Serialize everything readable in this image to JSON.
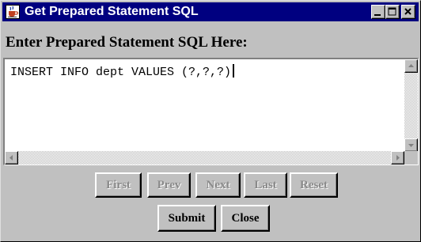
{
  "window": {
    "title": "Get Prepared Statement SQL",
    "controls": {
      "minimize": "minimize-icon",
      "maximize": "maximize-icon",
      "close": "close-icon"
    }
  },
  "prompt": "Enter Prepared Statement SQL Here:",
  "editor": {
    "value": "INSERT INFO dept VALUES (?,?,?)"
  },
  "nav_buttons": [
    {
      "label": "First",
      "enabled": false
    },
    {
      "label": "Prev",
      "enabled": false
    },
    {
      "label": "Next",
      "enabled": false
    },
    {
      "label": "Last",
      "enabled": false
    },
    {
      "label": "Reset",
      "enabled": false
    }
  ],
  "action_buttons": {
    "submit": "Submit",
    "close": "Close"
  },
  "colors": {
    "titlebar": "#000080",
    "face": "#c0c0c0",
    "disabled_text": "#8a8a8a"
  }
}
